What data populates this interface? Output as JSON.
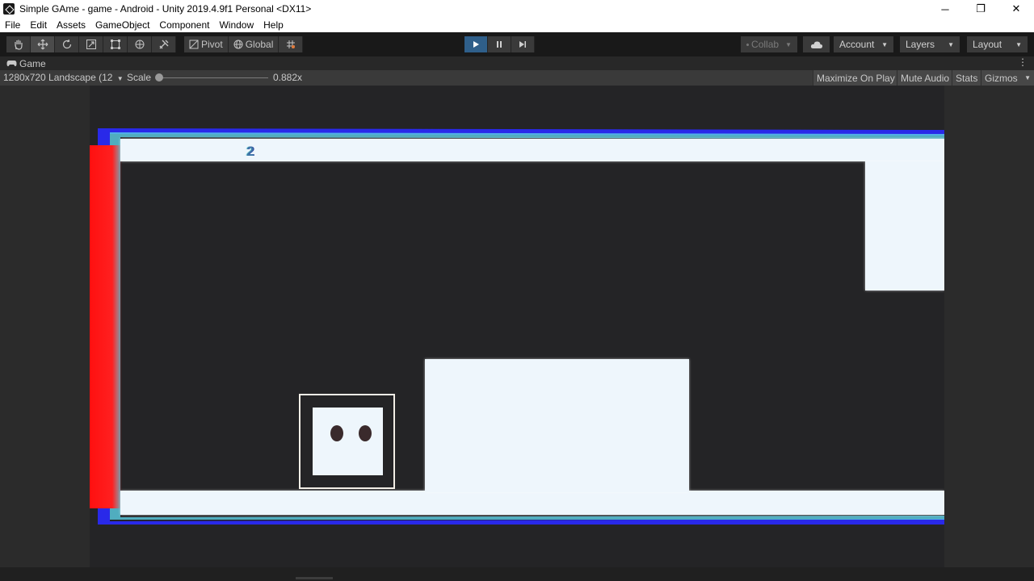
{
  "window": {
    "title": "Simple GAme - game - Android - Unity 2019.4.9f1 Personal <DX11>",
    "controls": [
      "─",
      "❐",
      "✕"
    ]
  },
  "menu": [
    "File",
    "Edit",
    "Assets",
    "GameObject",
    "Component",
    "Window",
    "Help"
  ],
  "toolbar": {
    "pivot_label": "Pivot",
    "global_label": "Global",
    "collab_label": "Collab",
    "account_label": "Account",
    "layers_label": "Layers",
    "layout_label": "Layout"
  },
  "game_tab": {
    "label": "Game"
  },
  "game_view": {
    "resolution": "1280x720 Landscape (12",
    "scale_label": "Scale",
    "scale_value": "0.882x",
    "maximize_label": "Maximize On Play",
    "mute_label": "Mute Audio",
    "stats_label": "Stats",
    "gizmos_label": "Gizmos"
  },
  "game": {
    "level_number": "2",
    "colors": {
      "platform": "#eef6fc",
      "background": "#242426",
      "hazard": "#ff1a1a",
      "edge_glow": "#2a2aff"
    }
  },
  "colors": {
    "play_active": "#2f5f8a",
    "toolbar_bg": "#191919",
    "button_bg": "#3a3a3a"
  }
}
